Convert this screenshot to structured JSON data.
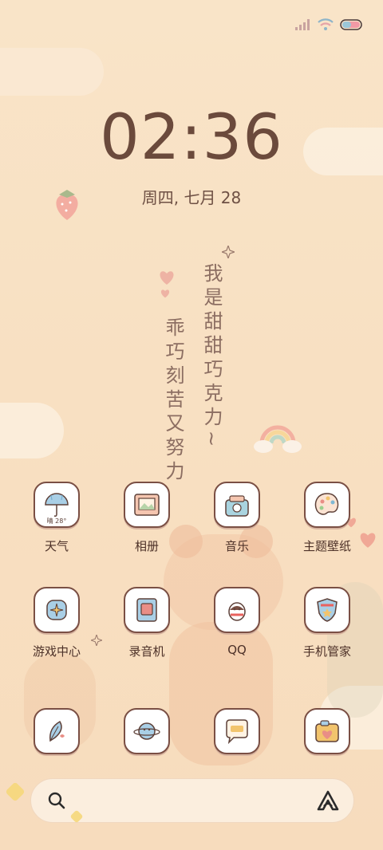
{
  "status_bar": {
    "signal_icon": "signal-bars-icon",
    "wifi_icon": "wifi-icon",
    "battery_icon": "battery-icon"
  },
  "lockscreen": {
    "time": "02:36",
    "date": "周四, 七月 28"
  },
  "wallpaper_text": {
    "line1": "我是甜甜巧克力~",
    "line2": "乖巧刻苦又努力"
  },
  "apps": [
    {
      "label": "天气",
      "icon": "umbrella-weather-icon",
      "badge": "晴 28°"
    },
    {
      "label": "相册",
      "icon": "photo-frame-icon"
    },
    {
      "label": "音乐",
      "icon": "radio-icon"
    },
    {
      "label": "主题壁纸",
      "icon": "palette-icon"
    },
    {
      "label": "游戏中心",
      "icon": "game-controller-icon"
    },
    {
      "label": "录音机",
      "icon": "recorder-icon"
    },
    {
      "label": "QQ",
      "icon": "qq-penguin-icon"
    },
    {
      "label": "手机管家",
      "icon": "shield-icon"
    },
    {
      "label": "",
      "icon": "feather-icon"
    },
    {
      "label": "",
      "icon": "planet-icon"
    },
    {
      "label": "",
      "icon": "chat-bubble-icon"
    },
    {
      "label": "",
      "icon": "camera-heart-icon"
    }
  ],
  "search_bar": {
    "search_icon": "search-icon",
    "assistant_icon": "assistant-logo-icon"
  }
}
